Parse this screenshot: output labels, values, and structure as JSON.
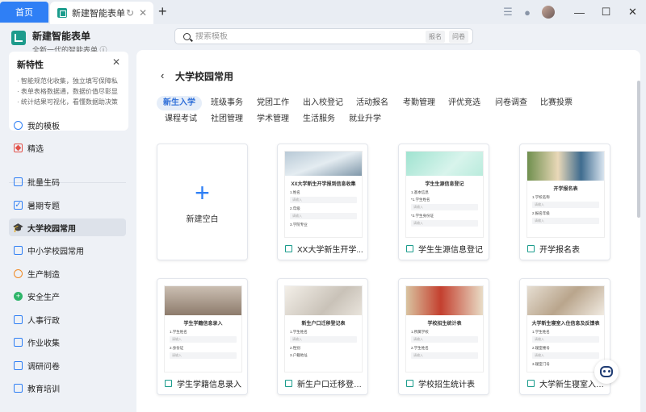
{
  "titlebar": {
    "home_tab": "首页",
    "active_tab": "新建智能表单",
    "reload_icon": "reload-icon",
    "close_icon": "close-icon"
  },
  "sidebar": {
    "app_name": "新建智能表单",
    "app_sub": "全新一代的智能表单",
    "info_icon": "ⓘ",
    "news": {
      "title": "新特性",
      "lines": [
        "· 智能规范化收集，独立填写保障私",
        "· 表单表格数据通，数据价值尽彰显",
        "· 统计结果可视化，看懂数据助决策"
      ]
    },
    "items": [
      {
        "label": "我的模板",
        "icon": "user-icon"
      },
      {
        "label": "精选",
        "icon": "gem-icon"
      },
      {
        "label": "批量生码",
        "icon": "qrcode-icon"
      },
      {
        "label": "暑期专题",
        "icon": "calendar-check-icon"
      },
      {
        "label": "大学校园常用",
        "icon": "graduation-cap-icon"
      },
      {
        "label": "中小学校园常用",
        "icon": "school-icon"
      },
      {
        "label": "生产制造",
        "icon": "factory-icon"
      },
      {
        "label": "安全生产",
        "icon": "plus-circle-icon"
      },
      {
        "label": "人事行政",
        "icon": "id-card-icon"
      },
      {
        "label": "作业收集",
        "icon": "inbox-icon"
      },
      {
        "label": "调研问卷",
        "icon": "survey-icon"
      },
      {
        "label": "教育培训",
        "icon": "book-icon"
      }
    ]
  },
  "search": {
    "placeholder": "搜索模板",
    "tags": [
      "报名",
      "问卷"
    ]
  },
  "main": {
    "title": "大学校园常用",
    "categories_row1": [
      "新生入学",
      "班级事务",
      "党团工作",
      "出入校登记",
      "活动报名",
      "考勤管理",
      "评优竞选",
      "问卷调查",
      "比赛投票"
    ],
    "categories_row2": [
      "课程考试",
      "社团管理",
      "学术管理",
      "生活服务",
      "就业升学"
    ],
    "blank_card": "新建空白",
    "templates": [
      {
        "label": "XX大学新生开学...",
        "thumb_title": "XX大学新生开学报到信息收集",
        "fields": [
          "1.姓名",
          "2.年级",
          "3.学院专业"
        ],
        "placeholder": "请输入",
        "header": "mountain"
      },
      {
        "label": "学生生源信息登记",
        "thumb_title": "学生生源信息登记",
        "fields": [
          "1.基本信息",
          "*1.学生姓名",
          "*2.学生身份证"
        ],
        "placeholder": "请输入",
        "header": "mint"
      },
      {
        "label": "开学报名表",
        "thumb_title": "开学报名表",
        "fields": [
          "1.学校名称",
          "2.报名年级"
        ],
        "placeholder": "请输入",
        "header": "kids"
      },
      {
        "label": "学生学籍信息录入",
        "thumb_title": "学生学籍信息录入",
        "fields": [
          "1.学生姓名",
          "2.身份证"
        ],
        "placeholder": "请输入",
        "header": "desk"
      },
      {
        "label": "新生户口迁移登记表",
        "thumb_title": "新生户口迁移登记表",
        "fields": [
          "1.学生姓名",
          "2.性别",
          "3.户籍地址"
        ],
        "placeholder": "请输入",
        "header": "hand"
      },
      {
        "label": "学校招生统计表",
        "thumb_title": "学校招生统计表",
        "fields": [
          "1.所属学校",
          "2.学生姓名"
        ],
        "placeholder": "请输入",
        "header": "girl"
      },
      {
        "label": "大学新生寝室入住...",
        "thumb_title": "大学新生寝室入住信息及反馈表",
        "fields": [
          "1.学生姓名",
          "2.寝室楼号",
          "3.寝室门号"
        ],
        "placeholder": "请输入",
        "header": "paper"
      }
    ]
  },
  "colors": {
    "accent": "#2f7ff5",
    "brand": "#1e9b8c"
  }
}
